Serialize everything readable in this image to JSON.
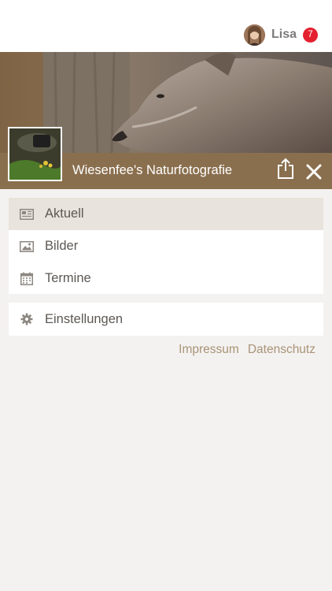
{
  "user": {
    "name": "Lisa",
    "notification_count": "7"
  },
  "site": {
    "title": "Wiesenfee's Naturfotografie"
  },
  "menu": {
    "main_items": [
      {
        "label": "Aktuell",
        "icon": "newspaper-icon",
        "active": true
      },
      {
        "label": "Bilder",
        "icon": "image-icon",
        "active": false
      },
      {
        "label": "Termine",
        "icon": "calendar-icon",
        "active": false
      }
    ],
    "settings": {
      "label": "Einstellungen",
      "icon": "gear-icon"
    }
  },
  "footer": {
    "imprint": "Impressum",
    "privacy": "Datenschutz"
  },
  "colors": {
    "accent": "#8a6f4e",
    "active_row": "#e8e3dc",
    "link": "#a89377",
    "badge": "#e4202f"
  }
}
